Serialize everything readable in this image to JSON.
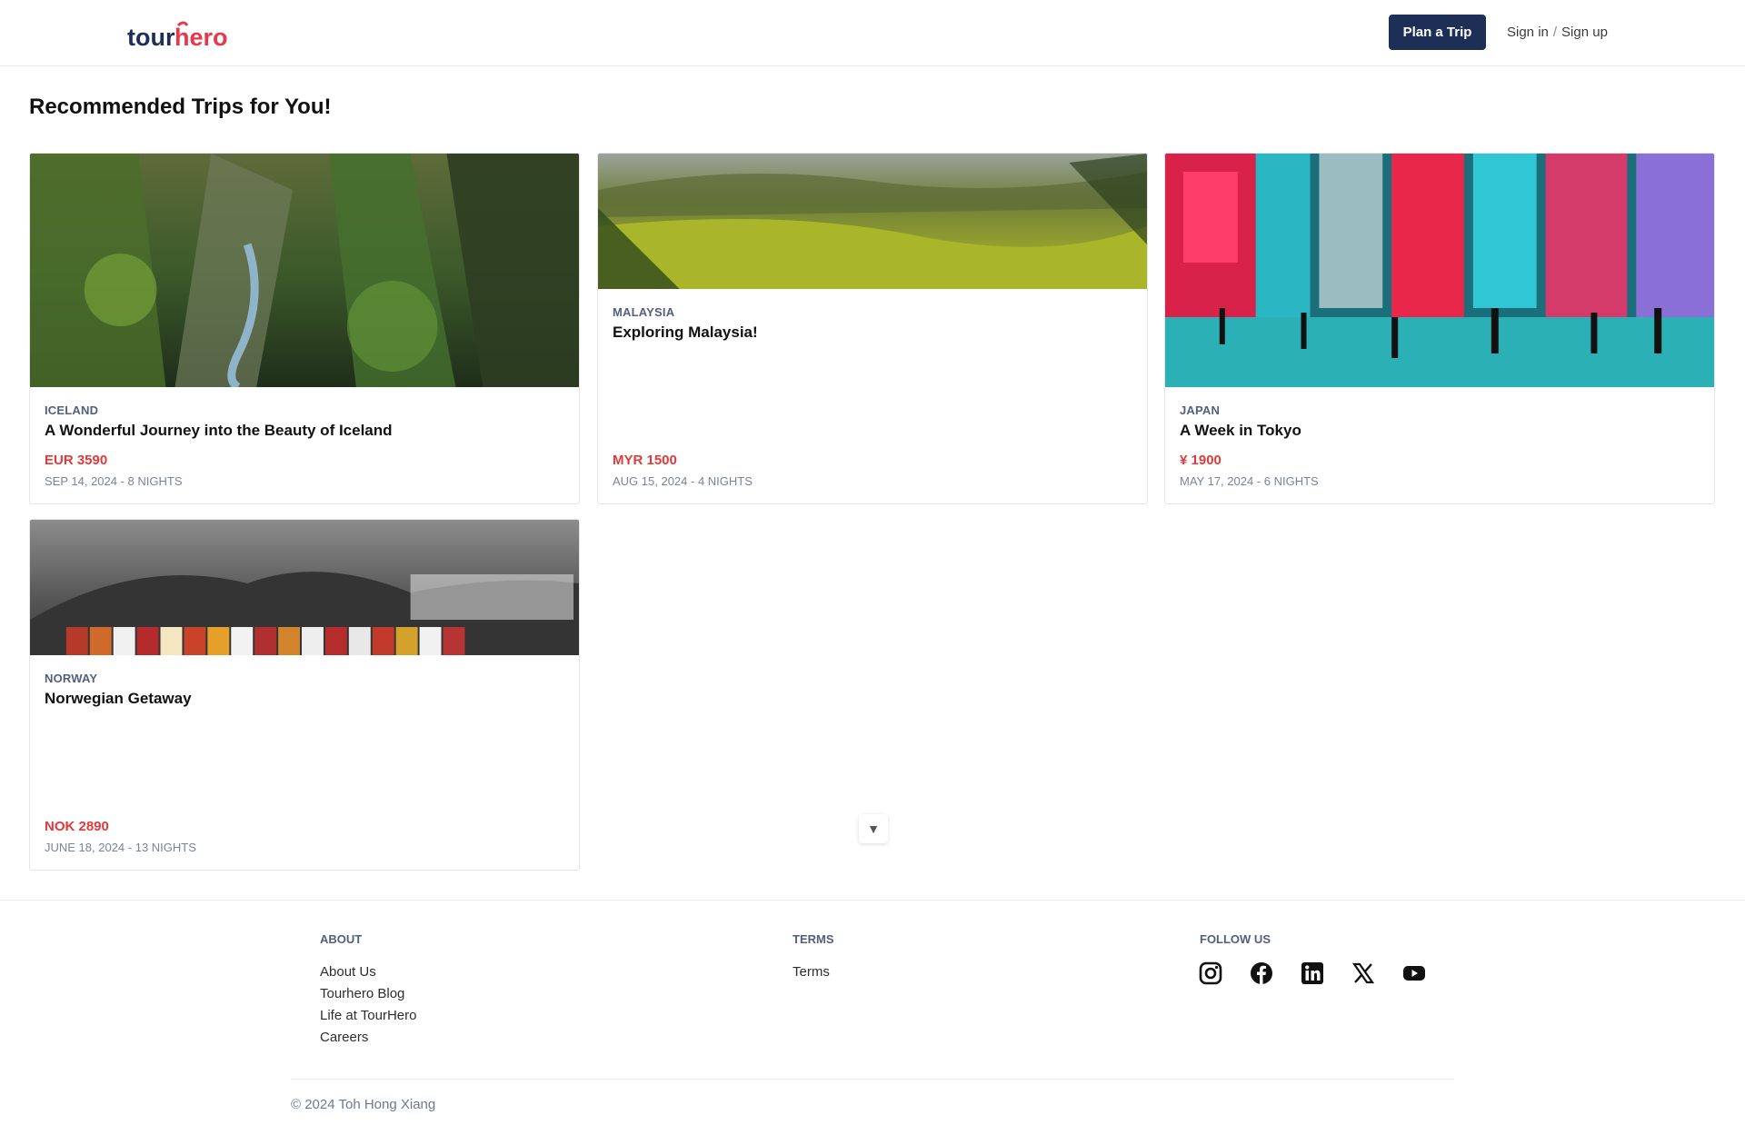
{
  "header": {
    "logo_text": "tourhero",
    "plan_trip_label": "Plan a Trip",
    "sign_in_label": "Sign in",
    "separator": "/",
    "sign_up_label": "Sign up"
  },
  "main": {
    "title": "Recommended Trips for You!",
    "trips": [
      {
        "country": "ICELAND",
        "title": "A Wonderful Journey into the Beauty of Iceland",
        "price": "EUR 3590",
        "date": "SEP 14, 2024 - 8 NIGHTS"
      },
      {
        "country": "MALAYSIA",
        "title": "Exploring Malaysia!",
        "price": "MYR 1500",
        "date": "AUG 15, 2024 - 4 NIGHTS"
      },
      {
        "country": "JAPAN",
        "title": "A Week in Tokyo",
        "price": "¥ 1900",
        "date": "MAY 17, 2024 - 6 NIGHTS"
      },
      {
        "country": "NORWAY",
        "title": "Norwegian Getaway",
        "price": "NOK 2890",
        "date": "JUNE 18, 2024 - 13 NIGHTS"
      }
    ]
  },
  "footer": {
    "about_heading": "ABOUT",
    "about_links": [
      "About Us",
      "Tourhero Blog",
      "Life at TourHero",
      "Careers"
    ],
    "terms_heading": "TERMS",
    "terms_links": [
      "Terms"
    ],
    "follow_heading": "FOLLOW US",
    "social_icons": [
      "instagram-icon",
      "facebook-icon",
      "linkedin-icon",
      "x-icon",
      "youtube-icon"
    ],
    "copyright": "© 2024 Toh Hong Xiang"
  },
  "colors": {
    "brand_navy": "#1d2f56",
    "brand_red": "#e8374c",
    "price_red": "#e03a3a"
  }
}
